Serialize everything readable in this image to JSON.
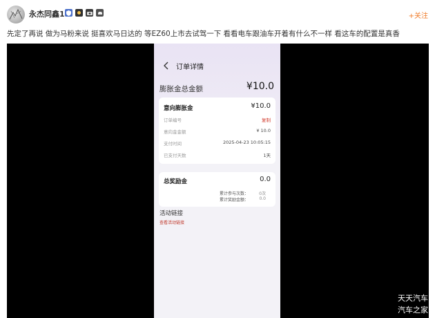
{
  "post": {
    "username": "永杰同鑫11",
    "follow_label": "+关注",
    "text": "先定了再说 做为马粉来说 挺喜欢马日达的 等EZ60上市去试驾一下 看看电车跟油车开着有什么不一样 看这车的配置是真香",
    "badge_icons": [
      "shield-badge-icon",
      "medal-badge-icon",
      "camera-badge-icon",
      "car-badge-icon"
    ]
  },
  "phone": {
    "page_title": "订单详情",
    "total_label": "膨胀金总金额",
    "total_value": "¥10.0",
    "card1": {
      "title": "意向膨胀金",
      "value": "¥10.0",
      "rows": [
        {
          "label": "订单编号",
          "value": "复制"
        },
        {
          "label": "意向金金额",
          "value": "¥ 10.0"
        },
        {
          "label": "支付时间",
          "value": "2025-04-23 10:05:15"
        },
        {
          "label": "已支付天数",
          "value": "1天"
        }
      ]
    },
    "card2": {
      "title": "总奖励金",
      "value": "0.0",
      "rows": [
        {
          "label": "累计参与次数：",
          "value": "0次"
        },
        {
          "label": "累计奖励金额：",
          "value": "0.0"
        }
      ]
    },
    "activity": {
      "title": "活动链接",
      "link": "查看活动链接"
    }
  },
  "watermark": {
    "line1": "天天汽车",
    "line2": "汽车之家"
  },
  "colors": {
    "follow": "#f07c2a",
    "link": "#c0392b",
    "video_background": "#000000",
    "phone_background": "#f3f2f7"
  }
}
